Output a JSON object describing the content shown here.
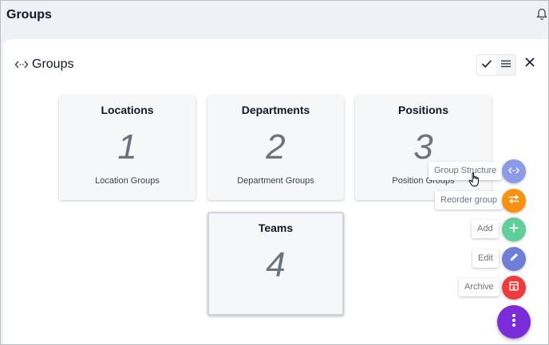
{
  "header": {
    "title": "Groups"
  },
  "panel": {
    "title": "Groups"
  },
  "cards": [
    {
      "name": "Locations",
      "count": "1",
      "sub": "Location Groups"
    },
    {
      "name": "Departments",
      "count": "2",
      "sub": "Department Groups"
    },
    {
      "name": "Positions",
      "count": "3",
      "sub": "Position Groups"
    },
    {
      "name": "Teams",
      "count": "4",
      "sub": ""
    }
  ],
  "fab_menu": [
    {
      "label": "Group Structure",
      "icon": "code-arrows-icon",
      "color": "#8d9ae6"
    },
    {
      "label": "Reorder group",
      "icon": "swap-arrows-icon",
      "color": "#f7910f"
    },
    {
      "label": "Add",
      "icon": "plus-icon",
      "color": "#5fcf9a"
    },
    {
      "label": "Edit",
      "icon": "pencil-icon",
      "color": "#6f7fd8"
    },
    {
      "label": "Archive",
      "icon": "archive-icon",
      "color": "#ef3b3b"
    }
  ],
  "fab_main": {
    "icon": "more-vertical-icon",
    "color": "#8a2be2"
  },
  "colors": {
    "accent": "#7b2cd9"
  }
}
